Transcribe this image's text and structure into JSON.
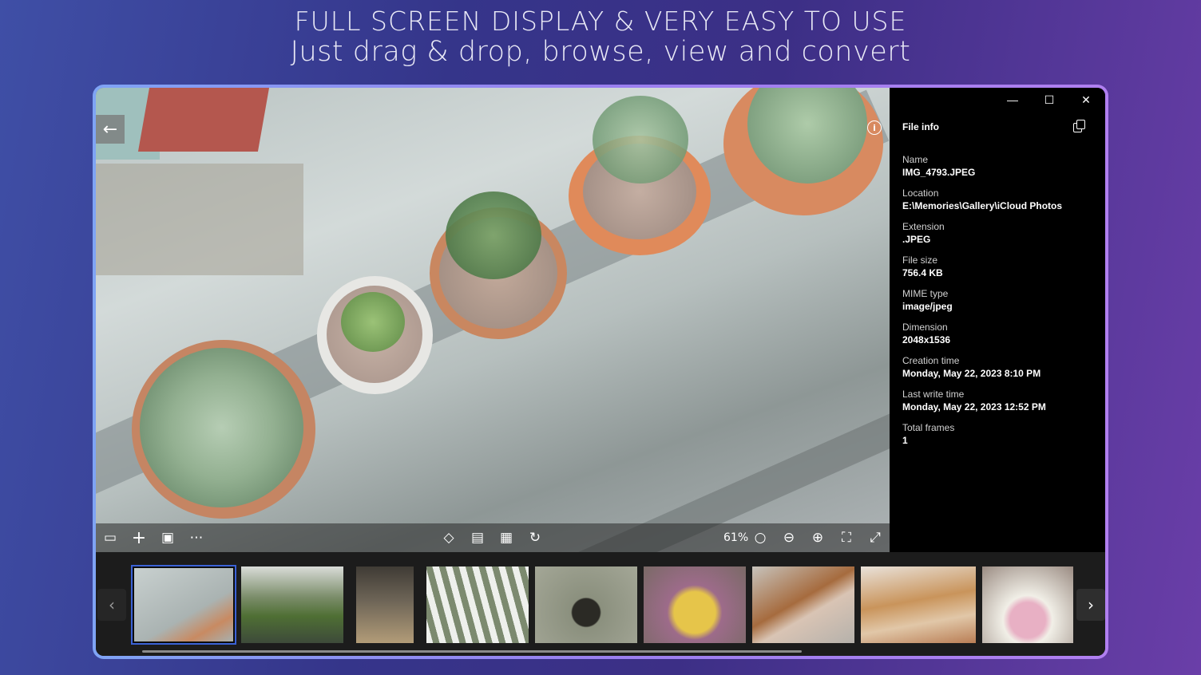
{
  "headline": {
    "line1": "FULL SCREEN DISPLAY & VERY EASY TO USE",
    "line2": "Just drag & drop, browse, view and convert"
  },
  "viewer": {
    "zoom": "61%",
    "toolbar_left_icons": [
      "slideshow-icon",
      "add-icon",
      "save-icon",
      "more-icon"
    ],
    "toolbar_center_icons": [
      "eraser-icon",
      "convert-icon",
      "image-edit-icon",
      "rotate-icon"
    ],
    "toolbar_right_icons": [
      "zoom-icon",
      "zoom-out-icon",
      "zoom-in-icon",
      "fit-icon",
      "fullscreen-icon"
    ]
  },
  "panel": {
    "title": "File info",
    "fields": [
      {
        "key": "Name",
        "value": "IMG_4793.JPEG"
      },
      {
        "key": "Location",
        "value": "E:\\Memories\\Gallery\\iCloud Photos"
      },
      {
        "key": "Extension",
        "value": ".JPEG"
      },
      {
        "key": "File size",
        "value": "756.4 KB"
      },
      {
        "key": "MIME type",
        "value": "image/jpeg"
      },
      {
        "key": "Dimension",
        "value": "2048x1536"
      },
      {
        "key": "Creation time",
        "value": "Monday, May 22, 2023 8:10 PM"
      },
      {
        "key": "Last write time",
        "value": "Monday, May 22, 2023 12:52 PM"
      },
      {
        "key": "Total frames",
        "value": "1"
      }
    ]
  },
  "thumbnails": [
    {
      "subject": "succulents",
      "color": "#b7c0c0",
      "selected": true
    },
    {
      "subject": "pond",
      "color": "#6b8a55"
    },
    {
      "subject": "patio",
      "color": "#5c5347"
    },
    {
      "subject": "fence",
      "color": "#c9cec8"
    },
    {
      "subject": "stairway",
      "color": "#7c8378"
    },
    {
      "subject": "lemons",
      "color": "#b79b6c"
    },
    {
      "subject": "wooden-spoon",
      "color": "#b8b4ad"
    },
    {
      "subject": "buffet",
      "color": "#d9cfc4"
    },
    {
      "subject": "flowers",
      "color": "#a88f8f"
    }
  ]
}
